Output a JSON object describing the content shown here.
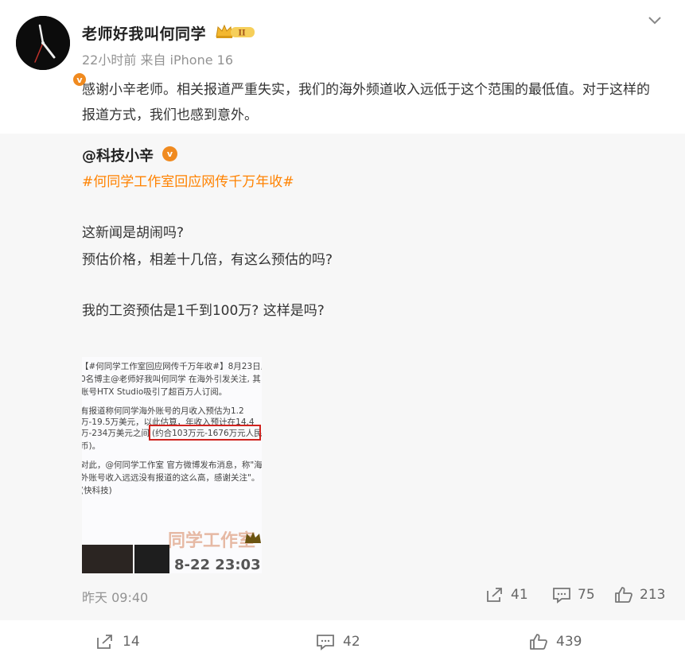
{
  "post": {
    "username": "老师好我叫何同学",
    "member_badge": "II",
    "time": "22小时前",
    "source": "来自 iPhone 16",
    "content": "感谢小辛老师。相关报道严重失实，我们的海外频道收入远低于这个范围的最低值。对于这样的报道方式，我们也感到意外。",
    "actions": {
      "repost": "14",
      "comment": "42",
      "like": "439"
    }
  },
  "repost": {
    "username": "@科技小辛",
    "hashtag": "#何同学工作室回应网传千万年收#",
    "lines": [
      "这新闻是胡闹吗?",
      "预估价格，相差十几倍，有这么预估的吗?",
      "我的工资预估是1千到100万? 这样是吗?"
    ],
    "time": "昨天 09:40",
    "actions": {
      "repost": "41",
      "comment": "75",
      "like": "213"
    },
    "image": {
      "lines": [
        "【#何同学工作室回应网传千万年收#】8月23日,",
        "0名博主@老师好我叫何同学 在海外引发关注, 其",
        "账号HTX Studio吸引了超百万人订阅。",
        "有报道称何同学海外账号的月收入预估为1.2",
        "万-19.5万美元，以此估算，年收入预计在14.4",
        "万-234万美元之间",
        "(约合103万元-1676万元人民",
        "币)。",
        "对此，@何同学工作室 官方微博发布消息，称\"海",
        "外账号收入远远没有报道的这么高，感谢关注\"。",
        "(快科技)"
      ],
      "watermark": "同学工作室",
      "watermark_date": "8-22 23:03"
    }
  },
  "colors": {
    "accent": "#ff8200",
    "verified": "#f08a1f",
    "highlight_box": "#d0231f",
    "repost_bg": "#f7f7f7"
  }
}
